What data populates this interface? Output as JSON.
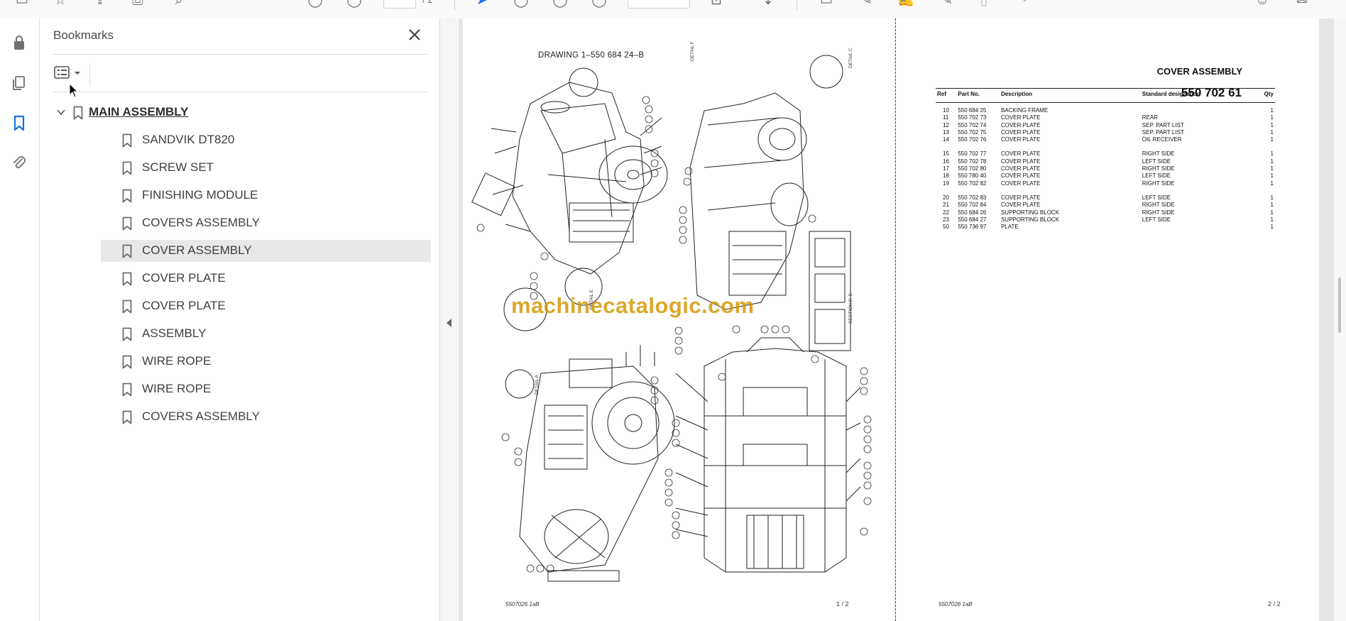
{
  "toolbar": {
    "page_current": "",
    "page_total": "/ 2",
    "zoom_value": "",
    "icons": [
      "menu-icon",
      "star-icon",
      "share-icon",
      "print-icon",
      "search-icon",
      "info-icon",
      "download-icon",
      "select-cursor-icon",
      "zoom-out-icon",
      "zoom-in-icon",
      "history-icon",
      "fit-page-icon",
      "scroll-down-icon",
      "comment-icon",
      "highlight-icon",
      "draw-icon",
      "edit-icon",
      "delete-icon",
      "redo-icon",
      "user-icon",
      "mail-icon"
    ]
  },
  "left_rail": {
    "icons": [
      "lock-icon",
      "pages-icon",
      "bookmark-icon",
      "attachment-icon"
    ]
  },
  "bookmarks": {
    "title": "Bookmarks",
    "items": [
      {
        "label": "MAIN ASSEMBLY",
        "level": 0
      },
      {
        "label": "SANDVIK DT820",
        "level": 1
      },
      {
        "label": "SCREW SET",
        "level": 1
      },
      {
        "label": "FINISHING MODULE",
        "level": 1
      },
      {
        "label": "COVERS ASSEMBLY",
        "level": 1
      },
      {
        "label": "COVER ASSEMBLY",
        "level": 1,
        "selected": true
      },
      {
        "label": "COVER PLATE",
        "level": 1
      },
      {
        "label": "COVER PLATE",
        "level": 1
      },
      {
        "label": "ASSEMBLY",
        "level": 1
      },
      {
        "label": "WIRE ROPE",
        "level": 1
      },
      {
        "label": "WIRE ROPE",
        "level": 1
      },
      {
        "label": "COVERS ASSEMBLY",
        "level": 1
      }
    ]
  },
  "page1": {
    "drawing_title": "DRAWING  1–550 684 24–B",
    "watermark": "machinecatalogic.com",
    "footer_code": "5507026 1aB",
    "footer_page": "1 /  2",
    "detail_labels": [
      "DETAIL F",
      "DETAIL C",
      "SECTION  B–B",
      "DETAIL  A",
      "DETAIL E"
    ]
  },
  "page2": {
    "title": "COVER ASSEMBLY",
    "part_number": "550 702 61",
    "footer_code": "5507026 1aB",
    "footer_page": "2 /  2",
    "table": {
      "headers": {
        "ref": "Ref",
        "part": "Part No.",
        "desc": "Description",
        "std": "Standard designation",
        "qty": "Qty"
      },
      "groups": [
        [
          {
            "ref": "10",
            "part": "550 684 25",
            "desc": "BACKING FRAME",
            "std": "",
            "qty": "1"
          },
          {
            "ref": "11",
            "part": "550 702 73",
            "desc": "COVER PLATE",
            "std": "REAR",
            "qty": "1"
          },
          {
            "ref": "12",
            "part": "550 702 74",
            "desc": "COVER PLATE",
            "std": "SEP. PART LIST",
            "qty": "1"
          },
          {
            "ref": "13",
            "part": "550 702 75",
            "desc": "COVER PLATE",
            "std": "SEP. PART LIST",
            "qty": "1"
          },
          {
            "ref": "14",
            "part": "550 702 76",
            "desc": "COVER PLATE",
            "std": "OIL RECEIVER",
            "qty": "1"
          }
        ],
        [
          {
            "ref": "15",
            "part": "550 702 77",
            "desc": "COVER PLATE",
            "std": "RIGHT SIDE",
            "qty": "1"
          },
          {
            "ref": "16",
            "part": "550 702 78",
            "desc": "COVER PLATE",
            "std": "LEFT SIDE",
            "qty": "1"
          },
          {
            "ref": "17",
            "part": "550 702 80",
            "desc": "COVER PLATE",
            "std": "RIGHT SIDE",
            "qty": "1"
          },
          {
            "ref": "18",
            "part": "550 780 40",
            "desc": "COVER PLATE",
            "std": "LEFT SIDE",
            "qty": "1"
          },
          {
            "ref": "19",
            "part": "550 702 82",
            "desc": "COVER PLATE",
            "std": "RIGHT SIDE",
            "qty": "1"
          }
        ],
        [
          {
            "ref": "20",
            "part": "550 702 83",
            "desc": "COVER PLATE",
            "std": "LEFT SIDE",
            "qty": "1"
          },
          {
            "ref": "21",
            "part": "550 702 84",
            "desc": "COVER PLATE",
            "std": "RIGHT SIDE",
            "qty": "1"
          },
          {
            "ref": "22",
            "part": "550 684 26",
            "desc": "SUPPORTING BLOCK",
            "std": "RIGHT SIDE",
            "qty": "1"
          },
          {
            "ref": "23",
            "part": "550 684 27",
            "desc": "SUPPORTING BLOCK",
            "std": "LEFT SIDE",
            "qty": "1"
          },
          {
            "ref": "50",
            "part": "550 736 97",
            "desc": "PLATE",
            "std": "",
            "qty": "1"
          }
        ]
      ]
    }
  }
}
